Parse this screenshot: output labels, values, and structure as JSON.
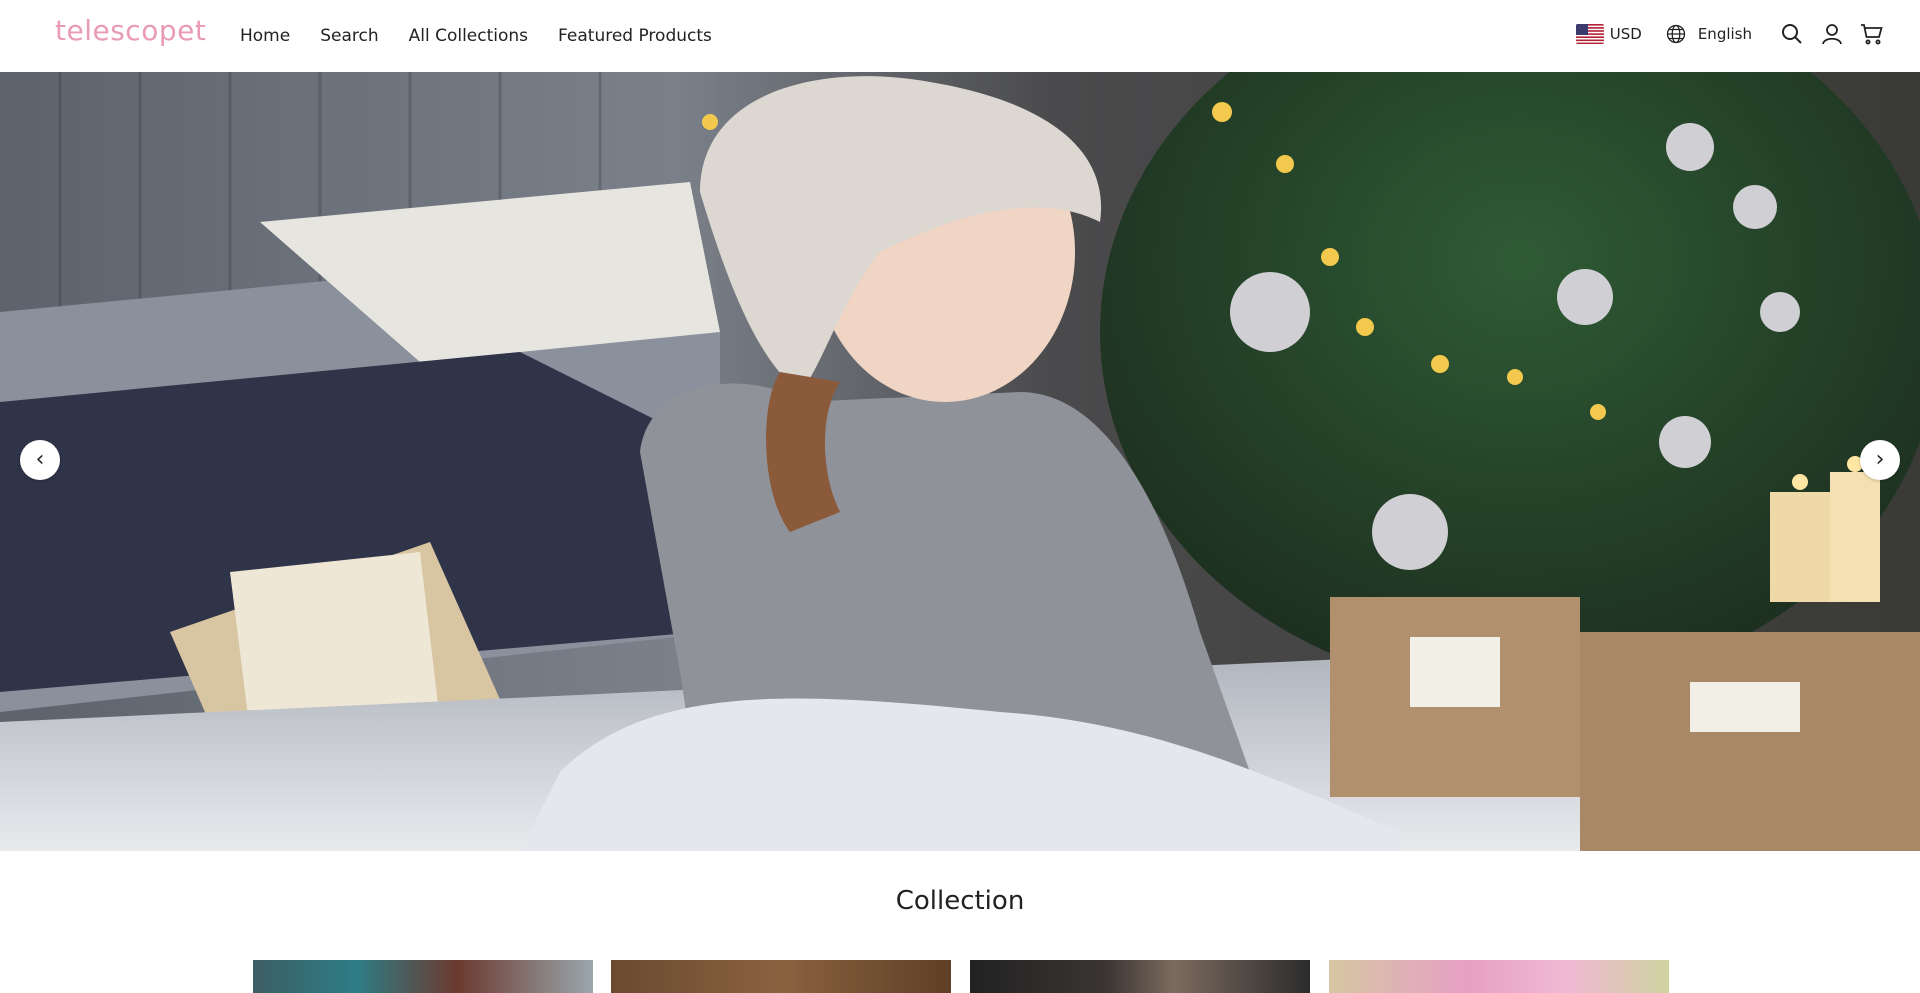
{
  "brand": {
    "logo_text": "telescopet"
  },
  "nav": {
    "items": [
      "Home",
      "Search",
      "All Collections",
      "Featured Products"
    ]
  },
  "header_right": {
    "currency": "USD",
    "language": "English"
  },
  "icons": {
    "search": "search-icon",
    "account": "user-icon",
    "cart": "cart-icon",
    "globe": "globe-icon",
    "flag": "us-flag-icon"
  },
  "hero": {
    "prev": "‹",
    "next": "›"
  },
  "collection": {
    "title": "Collection"
  },
  "colors": {
    "brand": "#e99ab4",
    "text": "#222222"
  }
}
